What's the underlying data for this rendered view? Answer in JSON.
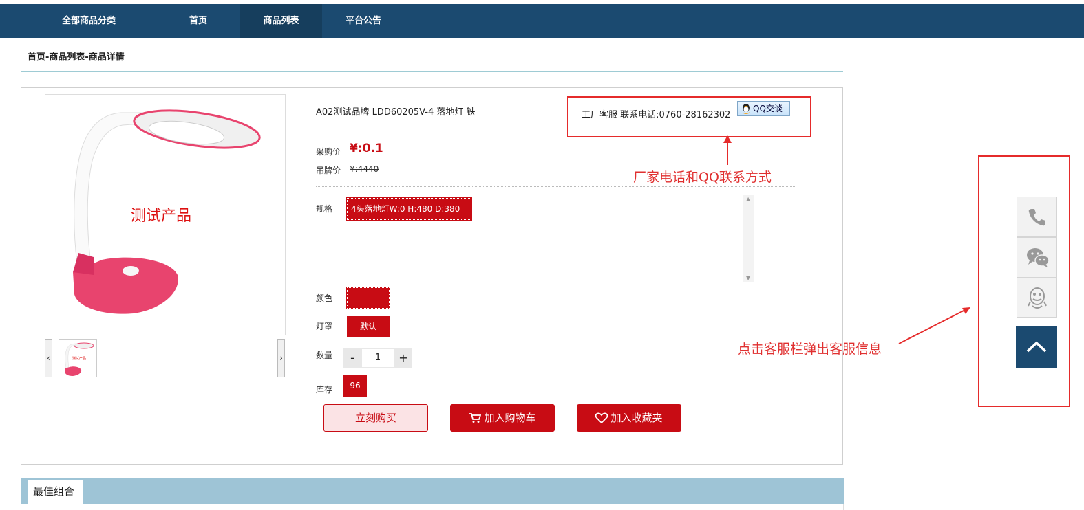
{
  "nav": {
    "items": [
      {
        "label": "全部商品分类"
      },
      {
        "label": "首页"
      },
      {
        "label": "商品列表"
      },
      {
        "label": "平台公告"
      }
    ],
    "active": "商品列表"
  },
  "breadcrumb": "首页-商品列表-商品详情",
  "product": {
    "image_label": "测试产品",
    "thumb_label": "测试产品",
    "name": "A02测试品牌 LDD60205V-4 落地灯 铁",
    "purchase_price_label": "采购价",
    "purchase_price": "¥:0.1",
    "tag_price_label": "吊牌价",
    "tag_price": "¥:4440",
    "spec_label": "规格",
    "spec_value": "4头落地灯W:0 H:480 D:380",
    "color_label": "颜色",
    "shade_label": "灯罩",
    "shade_value": "默认",
    "qty_label": "数量",
    "qty_minus": "-",
    "qty_value": "1",
    "qty_plus": "+",
    "stock_label": "库存",
    "stock_value": "96",
    "thumb_prev": "‹",
    "thumb_next": "›"
  },
  "contact": {
    "text": "工厂客服 联系电话:0760-28162302",
    "qq_label": "QQ交谈"
  },
  "annotations": {
    "contact_note": "厂家电话和QQ联系方式",
    "sidebar_note": "点击客服栏弹出客服信息"
  },
  "actions": {
    "buy_now": "立刻购买",
    "add_cart": "加入购物车",
    "add_fav": "加入收藏夹"
  },
  "combo": {
    "tab_label": "最佳组合"
  },
  "colors": {
    "nav_bg": "#1b4a70",
    "accent_red": "#c80c14",
    "annotation_red": "#e03030",
    "combo_bar": "#9ec4d6"
  },
  "sidebar": {
    "icons": [
      "phone-icon",
      "wechat-icon",
      "qq-icon",
      "back-to-top-icon"
    ]
  }
}
